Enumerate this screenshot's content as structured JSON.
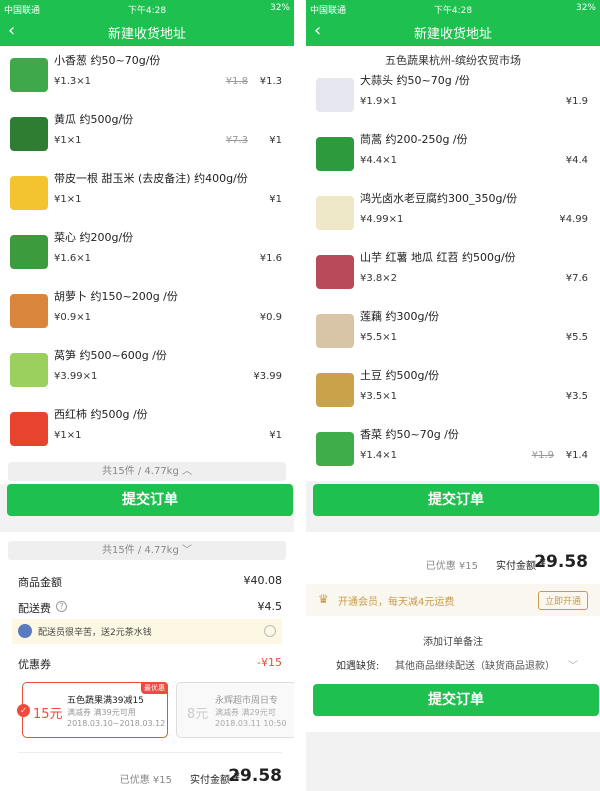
{
  "status": {
    "carrier": "中国联通",
    "time": "下午4:28",
    "battery": "32%"
  },
  "nav": {
    "title": "新建收货地址",
    "back": "‹"
  },
  "left_items": [
    {
      "name": "小香葱  约50~70g/份",
      "qty": "¥1.3×1",
      "orig": "¥1.8",
      "price": "¥1.3",
      "icon": "scallion-icon"
    },
    {
      "name": "黄瓜  约500g/份",
      "qty": "¥1×1",
      "orig": "¥7.3",
      "price": "¥1",
      "icon": "cucumber-icon"
    },
    {
      "name": "带皮一根 甜玉米  (去皮备注)  约400g/份",
      "qty": "¥1×1",
      "orig": "",
      "price": "¥1",
      "icon": "corn-icon"
    },
    {
      "name": "菜心  约200g/份",
      "qty": "¥1.6×1",
      "orig": "",
      "price": "¥1.6",
      "icon": "choysum-icon"
    },
    {
      "name": "胡萝卜 约150~200g /份",
      "qty": "¥0.9×1",
      "orig": "",
      "price": "¥0.9",
      "icon": "carrot-icon"
    },
    {
      "name": "莴笋 约500~600g /份",
      "qty": "¥3.99×1",
      "orig": "",
      "price": "¥3.99",
      "icon": "lettuce-stem-icon"
    },
    {
      "name": "西红柿 约500g /份",
      "qty": "¥1×1",
      "orig": "",
      "price": "¥1",
      "icon": "tomato-icon"
    }
  ],
  "summary": {
    "count_weight": "共15件 / 4.77kg",
    "chevron_up": "︿",
    "chevron_down": "﹀"
  },
  "submit_label": "提交订单",
  "fees": {
    "goods_label": "商品金额",
    "goods_value": "¥40.08",
    "delivery_label": "配送费",
    "delivery_value": "¥4.5",
    "info_icon": "?",
    "tip_text": "配送员很辛苦，送2元茶水钱",
    "coupon_label": "优惠券",
    "coupon_value": "-¥15"
  },
  "coupons": [
    {
      "badge": "最优惠",
      "amount": "15元",
      "title": "五色蔬果满39减15",
      "desc": "满减券  满39元可用",
      "date": "2018.03.10~2018.03.12"
    },
    {
      "amount": "8元",
      "title": "永辉超市周日专",
      "desc": "满减券  满29元可",
      "date": "2018.03.11 10:50"
    }
  ],
  "total": {
    "discount": "已优惠 ¥15",
    "label": "实付金额",
    "currency": "¥",
    "amount": "29.58"
  },
  "right_header": "五色蔬果杭州-缤纷农贸市场",
  "right_items": [
    {
      "name": "大蒜头 约50~70g /份",
      "qty": "¥1.9×1",
      "orig": "",
      "price": "¥1.9",
      "icon": "garlic-icon"
    },
    {
      "name": "茼蒿 约200-250g /份",
      "qty": "¥4.4×1",
      "orig": "",
      "price": "¥4.4",
      "icon": "crowndaisy-icon"
    },
    {
      "name": "鸿光卤水老豆腐约300_350g/份",
      "qty": "¥4.99×1",
      "orig": "",
      "price": "¥4.99",
      "icon": "tofu-icon"
    },
    {
      "name": "山芋   红薯 地瓜  红苕 约500g/份",
      "qty": "¥3.8×2",
      "orig": "",
      "price": "¥7.6",
      "icon": "sweetpotato-icon"
    },
    {
      "name": "莲藕   约300g/份",
      "qty": "¥5.5×1",
      "orig": "",
      "price": "¥5.5",
      "icon": "lotusroot-icon"
    },
    {
      "name": "土豆  约500g/份",
      "qty": "¥3.5×1",
      "orig": "",
      "price": "¥3.5",
      "icon": "potato-icon"
    },
    {
      "name": "香菜  约50~70g /份",
      "qty": "¥1.4×1",
      "orig": "¥1.9",
      "price": "¥1.4",
      "icon": "coriander-icon"
    }
  ],
  "member": {
    "text": "开通会员，每天减4元运费",
    "button": "立即开通"
  },
  "remark": {
    "add_note": "添加订单备注",
    "shortage_label": "如遇缺货:",
    "shortage_value": "其他商品继续配送（缺货商品退款）"
  },
  "colors": {
    "brand": "#1ec04f",
    "accent_red": "#f04a3a",
    "member_gold": "#c89b4a"
  }
}
